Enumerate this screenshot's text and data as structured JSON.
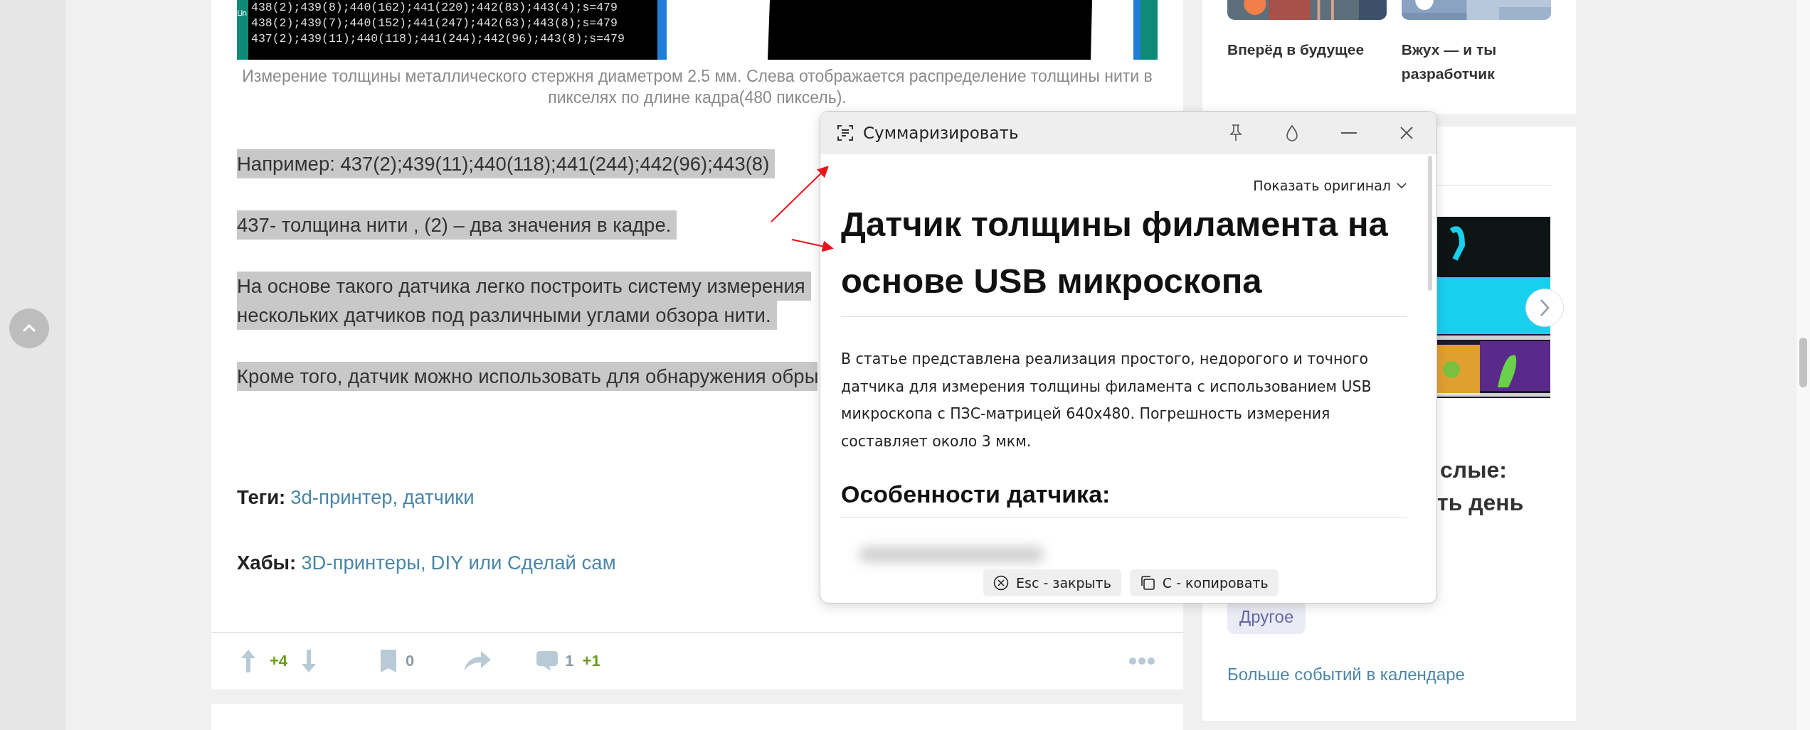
{
  "article": {
    "image": {
      "side_label": "Lin",
      "terminal_lines": [
        "438(2);439(8);440(162);441(220);442(83);443(4);s=479",
        "438(2);439(7);440(152);441(247);442(63);443(8);s=479",
        "437(2);439(11);440(118);441(244);442(96);443(8);s=479"
      ]
    },
    "caption": "Измерение толщины металлического стержня диаметром 2.5 мм. Слева отображается распределение толщины нити в пикселях по длине кадра(480 пиксель).",
    "paragraphs": [
      {
        "lines": [
          "Например: 437(2);439(11);440(118);441(244);442(96);443(8)"
        ]
      },
      {
        "lines": [
          "437- толщина нити , (2) – два значения в кадре."
        ]
      },
      {
        "lines": [
          "На основе такого датчика легко построить систему измерения",
          "нескольких датчиков под различными углами обзора нити."
        ]
      },
      {
        "lines": [
          "Кроме того, датчик можно использовать для обнаружения обры"
        ]
      }
    ],
    "tags": {
      "label": "Теги:",
      "links": [
        "3d-принтер,",
        "датчики"
      ]
    },
    "hubs": {
      "label": "Хабы:",
      "links": [
        "3D-принтеры,",
        "DIY или Сделай сам"
      ]
    },
    "actions": {
      "score": "+4",
      "bookmarks": "0",
      "comments": "1",
      "new_comments": "+1"
    }
  },
  "sidebar": {
    "cards": [
      {
        "title": "Вперёд в будущее"
      },
      {
        "title": "Вжух — и ты разработчик"
      }
    ],
    "event": {
      "title_fragments": [
        "слые:",
        "ть день"
      ],
      "tag": "Другое"
    },
    "more_link": "Больше событий в календаре"
  },
  "summary_popup": {
    "title": "Суммаризировать",
    "show_original": "Показать оригинал",
    "heading": "Датчик толщины филамента на основе USB микроскопа",
    "summary": "В статье представлена реализация простого, недорогого и точного датчика для измерения толщины филамента с использованием USB микроскопа с ПЗС-матрицей 640x480. Погрешность измерения составляет около 3 мкм.",
    "subheading": "Особенности датчика:",
    "buttons": [
      {
        "kind": "close",
        "label": "Esc - закрыть"
      },
      {
        "kind": "copy",
        "label": "С - копировать"
      }
    ]
  }
}
